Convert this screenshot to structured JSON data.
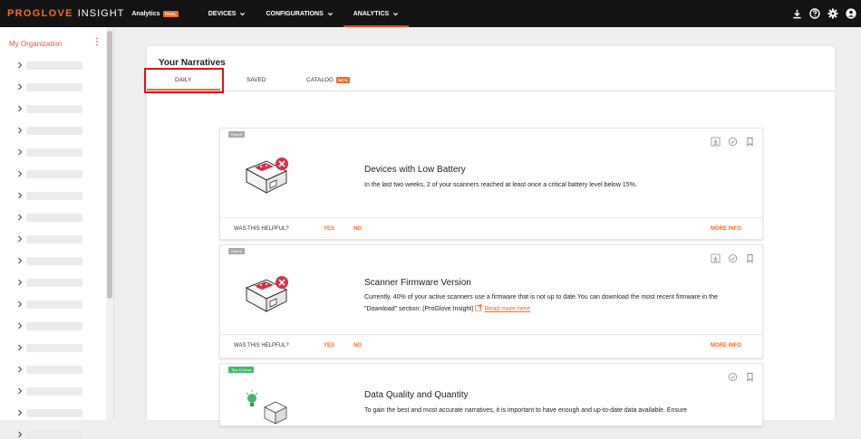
{
  "header": {
    "brand_pro": "PROGLOVE",
    "brand_insight": "INSIGHT",
    "product": "Analytics",
    "trial": "TRIAL",
    "nav": [
      {
        "label": "DEVICES"
      },
      {
        "label": "CONFIGURATIONS"
      },
      {
        "label": "ANALYTICS"
      }
    ],
    "icons": [
      "download-icon",
      "help-icon",
      "settings-icon",
      "account-icon"
    ]
  },
  "sidebar": {
    "org": "My Organization",
    "menu_glyph": "⋮"
  },
  "main": {
    "title": "Your Narratives",
    "tabs": [
      {
        "label": "DAILY"
      },
      {
        "label": "SAVED"
      },
      {
        "label": "CATALOG",
        "badge": "BETA"
      }
    ]
  },
  "cards": [
    {
      "badge": "Report",
      "title": "Devices with Low Battery",
      "desc": "In the last two weeks, 2 of your scanners reached at least once a critical battery level below 15%.",
      "footer": {
        "q": "WAS THIS HELPFUL?",
        "yes": "YES",
        "no": "NO",
        "more": "MORE INFO"
      }
    },
    {
      "badge": "Report",
      "title": "Scanner Firmware Version",
      "desc": "Currently, 40% of your active scanners use a firmware that is not up to date.You can download the most recent firmware in the \"Download\" section: (ProGlove Insight)",
      "link": "Read more here",
      "footer": {
        "q": "WAS THIS HELPFUL?",
        "yes": "YES",
        "no": "NO",
        "more": "MORE INFO"
      }
    },
    {
      "badge": "Tips & News",
      "title": "Data Quality and Quantity",
      "desc": "To gain the best and most accurate narratives, it is important to have enough and up-to-date data available. Ensure"
    }
  ],
  "colors": {
    "accent": "#f26a23",
    "highlight": "#d8141d",
    "topbar": "#141414"
  }
}
